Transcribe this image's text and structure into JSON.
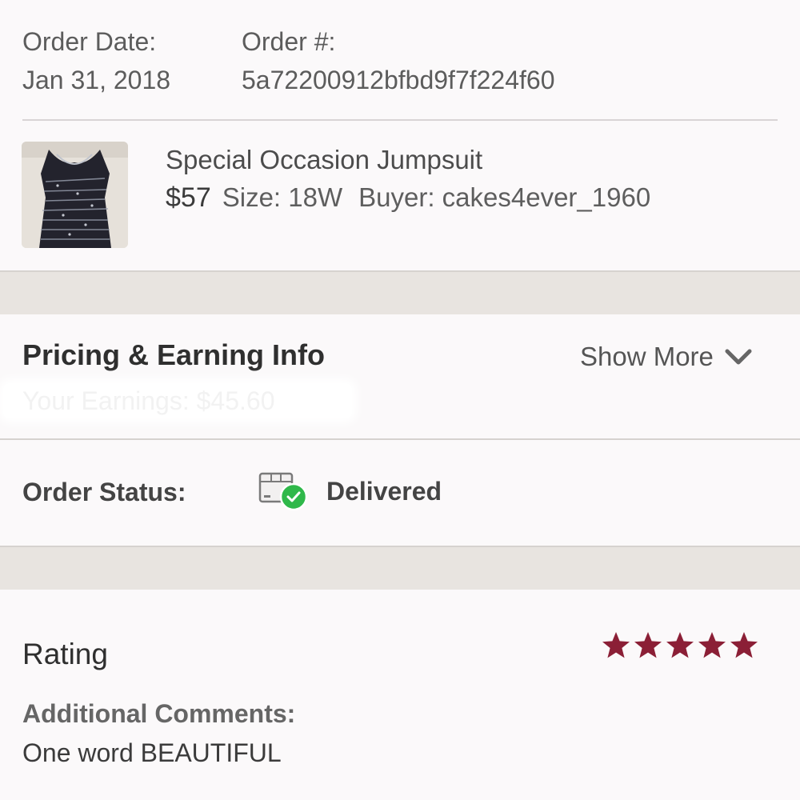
{
  "order": {
    "date_label": "Order Date:",
    "date_value": "Jan 31, 2018",
    "number_label": "Order #:",
    "number_value": "5a72200912bfbd9f7f224f60"
  },
  "product": {
    "image_icon": "jumpsuit-photo",
    "title": "Special Occasion Jumpsuit",
    "price": "$57",
    "size": "Size: 18W",
    "buyer": "Buyer: cakes4ever_1960"
  },
  "pricing": {
    "title": "Pricing & Earning Info",
    "show_more_label": "Show More",
    "show_more_icon": "chevron-down-icon",
    "earnings_text": "Your Earnings: $45.60"
  },
  "status": {
    "label": "Order Status:",
    "value": "Delivered",
    "icon": "delivered-box-check-icon",
    "check_color": "#2fb84a"
  },
  "rating": {
    "title": "Rating",
    "stars": 5,
    "max_stars": 5,
    "star_color": "#8b1f36",
    "comments_label": "Additional Comments:",
    "comments_text": "One word BEAUTIFUL"
  }
}
